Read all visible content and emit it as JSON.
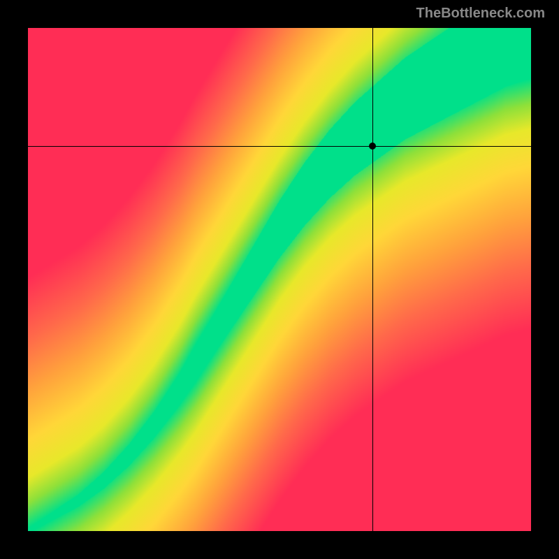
{
  "watermark": "TheBottleneck.com",
  "chart_data": {
    "type": "heatmap",
    "title": "",
    "xlabel": "",
    "ylabel": "",
    "xlim": [
      0,
      1
    ],
    "ylim": [
      0,
      1
    ],
    "crosshair": {
      "x": 0.685,
      "y": 0.765
    },
    "marker": {
      "x": 0.685,
      "y": 0.765
    },
    "ridge_points": [
      {
        "x": 0.0,
        "y": 0.0
      },
      {
        "x": 0.05,
        "y": 0.03
      },
      {
        "x": 0.1,
        "y": 0.06
      },
      {
        "x": 0.15,
        "y": 0.1
      },
      {
        "x": 0.2,
        "y": 0.15
      },
      {
        "x": 0.25,
        "y": 0.21
      },
      {
        "x": 0.3,
        "y": 0.28
      },
      {
        "x": 0.35,
        "y": 0.36
      },
      {
        "x": 0.4,
        "y": 0.44
      },
      {
        "x": 0.45,
        "y": 0.52
      },
      {
        "x": 0.5,
        "y": 0.6
      },
      {
        "x": 0.55,
        "y": 0.67
      },
      {
        "x": 0.6,
        "y": 0.73
      },
      {
        "x": 0.65,
        "y": 0.78
      },
      {
        "x": 0.7,
        "y": 0.82
      },
      {
        "x": 0.75,
        "y": 0.86
      },
      {
        "x": 0.8,
        "y": 0.89
      },
      {
        "x": 0.85,
        "y": 0.92
      },
      {
        "x": 0.9,
        "y": 0.95
      },
      {
        "x": 0.95,
        "y": 0.98
      },
      {
        "x": 1.0,
        "y": 1.0
      }
    ],
    "color_stops": [
      {
        "t": 0.0,
        "color": "#00e08a"
      },
      {
        "t": 0.1,
        "color": "#8ee03a"
      },
      {
        "t": 0.2,
        "color": "#e8e82a"
      },
      {
        "t": 0.35,
        "color": "#ffd738"
      },
      {
        "t": 0.55,
        "color": "#ffa23c"
      },
      {
        "t": 0.75,
        "color": "#ff6a4a"
      },
      {
        "t": 1.0,
        "color": "#ff2d55"
      }
    ],
    "ridge_width_start": 0.005,
    "ridge_width_end": 0.1,
    "falloff_scale": 0.5
  }
}
